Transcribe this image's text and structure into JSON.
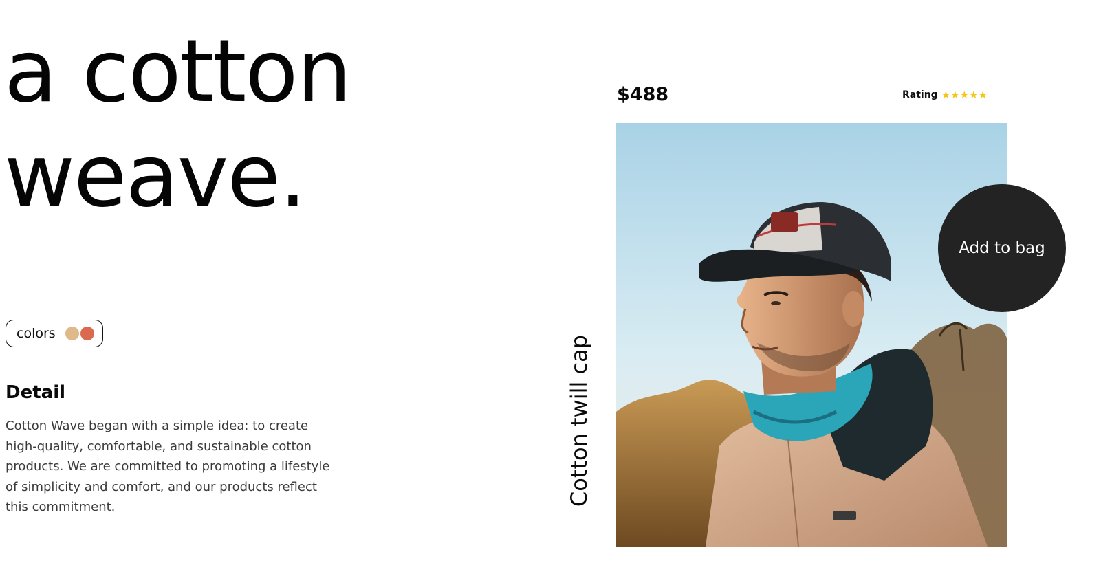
{
  "hero": {
    "headline_line1": "a cotton",
    "headline_line2": "weave."
  },
  "colors": {
    "label": "colors",
    "swatches": [
      "#e0b98a",
      "#d96a50"
    ]
  },
  "detail": {
    "title": "Detail",
    "text": "Cotton Wave began with a simple idea: to create high-quality, comfortable, and sustainable cotton products. We are committed to promoting a lifestyle of simplicity and comfort, and our products reflect this commitment."
  },
  "product": {
    "price": "$488",
    "rating_label": "Rating",
    "rating_value": 5,
    "rating_max": 5,
    "stars": "★★★★★",
    "name": "Cotton twill cap",
    "add_to_bag_label": "Add to bag"
  },
  "theme": {
    "star_color": "#f5c518",
    "button_color": "#232323"
  }
}
